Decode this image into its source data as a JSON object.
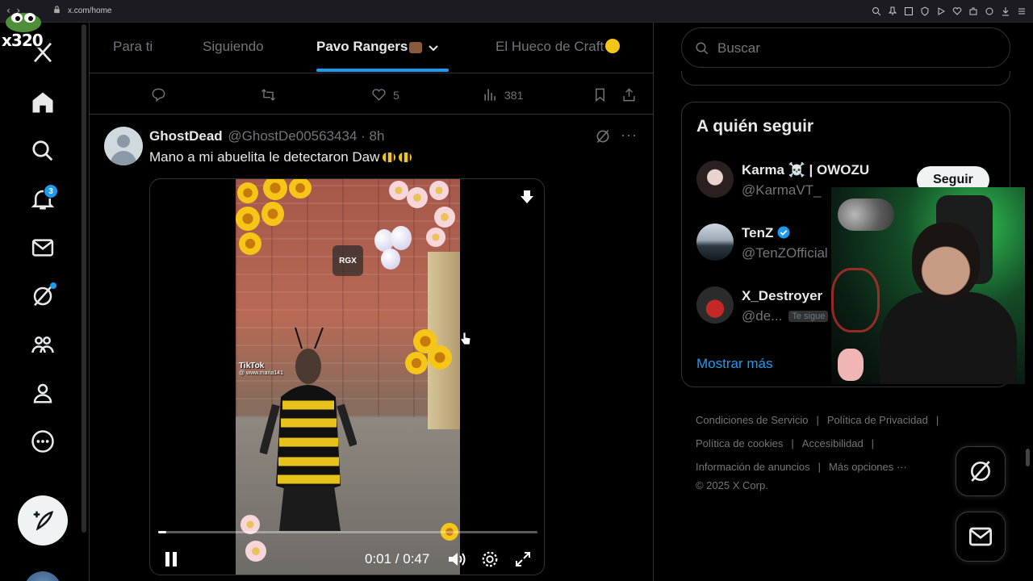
{
  "browser": {
    "url": "x.com/home"
  },
  "overlay": {
    "tag": "x320"
  },
  "nav": {
    "notifications_count": "3",
    "items": [
      "home-icon",
      "search-icon",
      "notifications-icon",
      "messages-icon",
      "grok-icon",
      "communities-icon",
      "profile-icon",
      "more-icon"
    ]
  },
  "tabs": [
    {
      "label": "Para ti"
    },
    {
      "label": "Siguiendo"
    },
    {
      "label": "Pavo Rangers"
    },
    {
      "label": "El Hueco de Craft"
    }
  ],
  "prev_tweet_actions": {
    "likes": "5",
    "views": "381"
  },
  "tweet": {
    "name": "GhostDead",
    "handle": "@GhostDe00563434 · 8h",
    "text": "Mano a mi abuelita le detectaron Daw",
    "video": {
      "watermark": "RGX",
      "tiktok_label": "TikTok",
      "tiktok_user": "@ www.maria141",
      "time": "0:01 / 0:47",
      "progress": 0.021
    }
  },
  "right": {
    "search_placeholder": "Buscar",
    "who_to_follow": {
      "title": "A quién seguir",
      "users": [
        {
          "name": "Karma ☠️ | OWOZU",
          "handle": "@KarmaVT_",
          "verified": false
        },
        {
          "name": "TenZ",
          "handle": "@TenZOfficial",
          "verified": true
        },
        {
          "name": "X_Destroyer",
          "handle": "@de...",
          "follows_you": "Te sigue"
        }
      ],
      "follow_label": "Seguir",
      "show_more": "Mostrar más"
    },
    "footer": {
      "terms": "Condiciones de Servicio",
      "privacy": "Política de Privacidad",
      "cookies": "Política de cookies",
      "accessibility": "Accesibilidad",
      "ads": "Información de anuncios",
      "more": "Más opciones ···",
      "copyright": "© 2025 X Corp."
    }
  },
  "colors": {
    "accent": "#1d9bf0",
    "background": "#000000",
    "text": "#e7e9ea",
    "muted": "#71767b"
  }
}
